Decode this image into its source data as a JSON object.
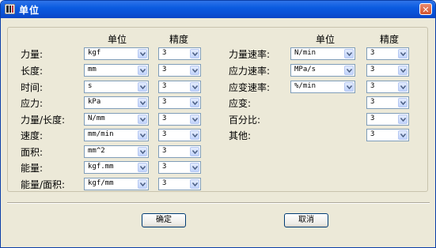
{
  "window": {
    "title": "单位",
    "close_glyph": "✕"
  },
  "left": {
    "header_unit": "单位",
    "header_precision": "精度",
    "rows": [
      {
        "label": "力量:",
        "unit": "kgf",
        "precision": "3"
      },
      {
        "label": "长度:",
        "unit": "mm",
        "precision": "3"
      },
      {
        "label": "时间:",
        "unit": "s",
        "precision": "3"
      },
      {
        "label": "应力:",
        "unit": "kPa",
        "precision": "3"
      },
      {
        "label": "力量/长度:",
        "unit": "N/mm",
        "precision": "3"
      },
      {
        "label": "速度:",
        "unit": "mm/min",
        "precision": "3"
      },
      {
        "label": "面积:",
        "unit": "mm^2",
        "precision": "3"
      },
      {
        "label": "能量:",
        "unit": "kgf.mm",
        "precision": "3"
      },
      {
        "label": "能量/面积:",
        "unit": "kgf/mm",
        "precision": "3"
      }
    ]
  },
  "right": {
    "header_unit": "单位",
    "header_precision": "精度",
    "rows": [
      {
        "label": "力量速率:",
        "unit": "N/min",
        "precision": "3"
      },
      {
        "label": "应力速率:",
        "unit": "MPa/s",
        "precision": "3"
      },
      {
        "label": "应变速率:",
        "unit": "%/min",
        "precision": "3"
      },
      {
        "label": "应变:",
        "unit": "",
        "precision": "3"
      },
      {
        "label": "百分比:",
        "unit": "",
        "precision": "3"
      },
      {
        "label": "其他:",
        "unit": "",
        "precision": "3"
      }
    ]
  },
  "buttons": {
    "ok": "确定",
    "cancel": "取消"
  },
  "icons": {
    "title": "app-icon",
    "dropdown": "chevron-down-icon"
  }
}
